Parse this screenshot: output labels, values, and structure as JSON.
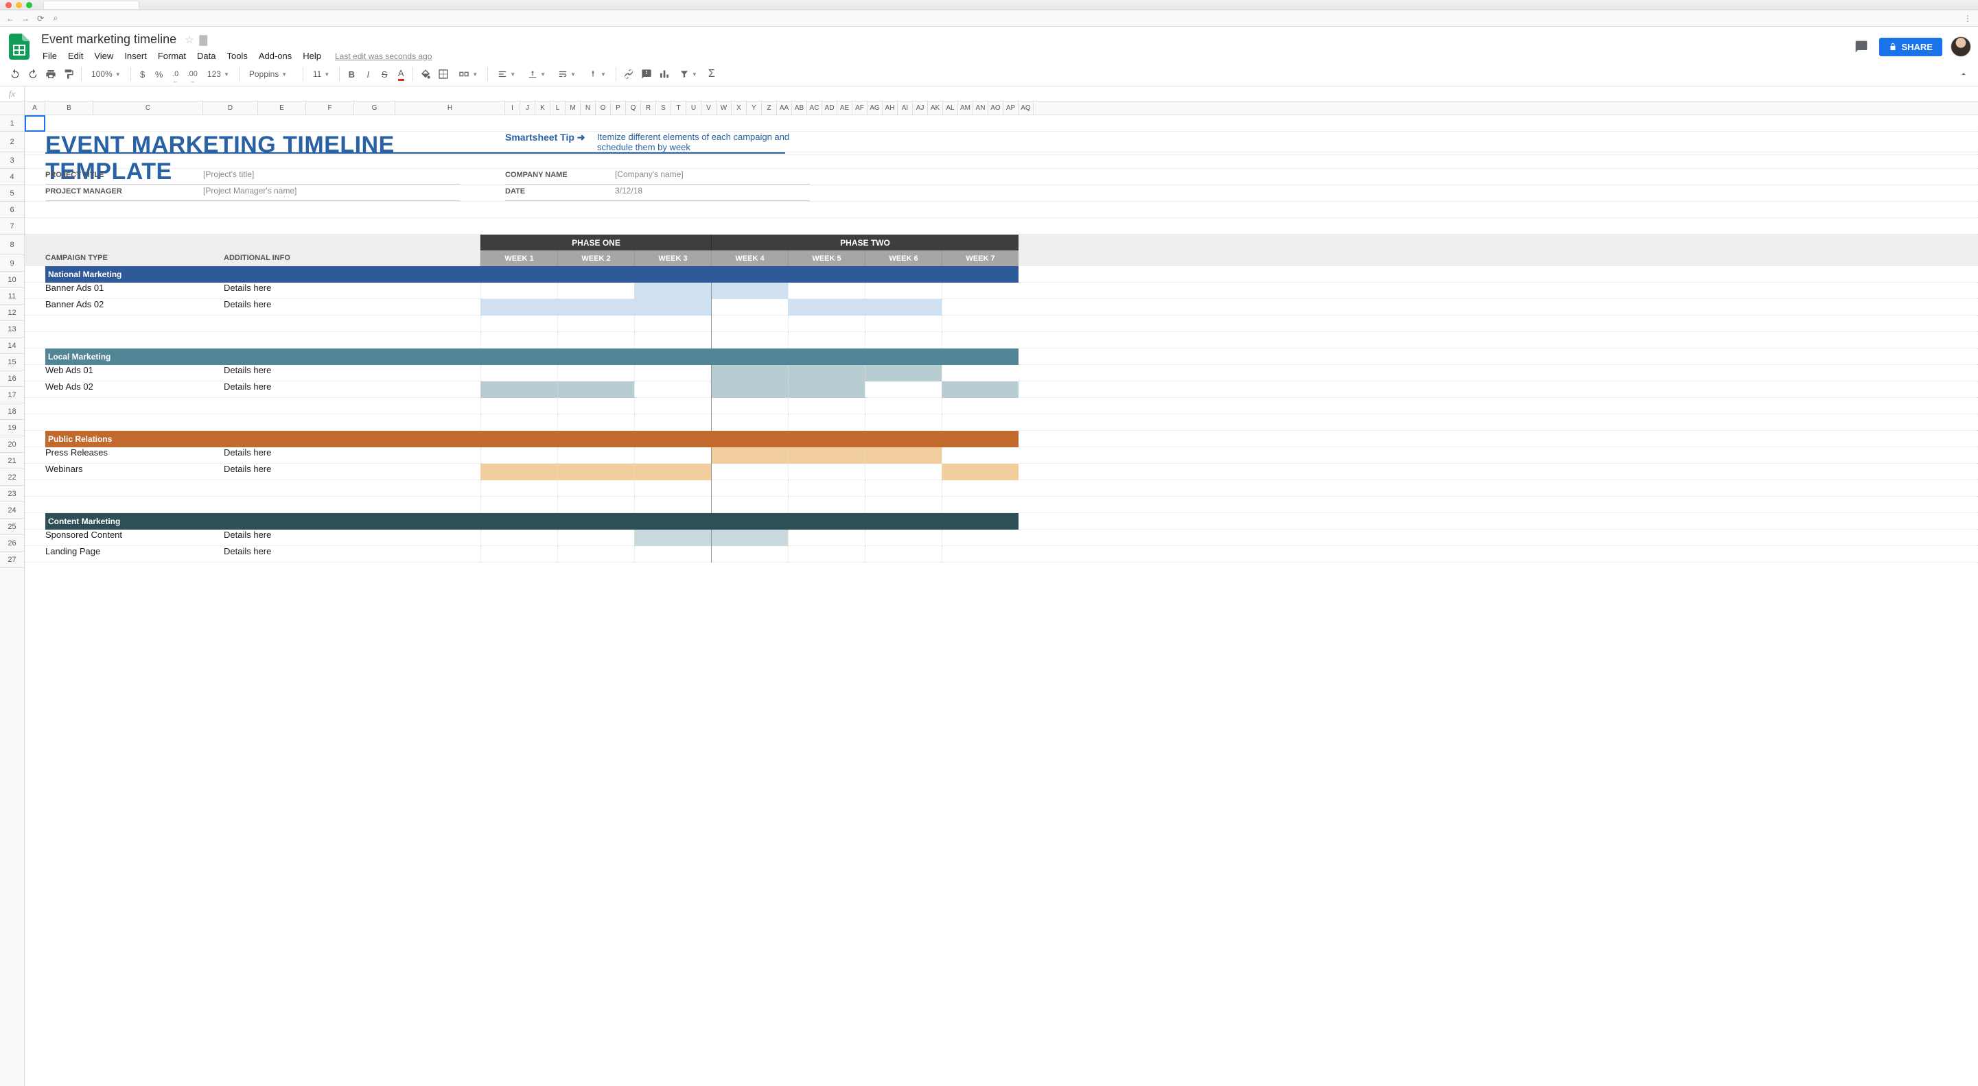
{
  "browser": {
    "back": "←",
    "forward": "→",
    "reload": "⟳",
    "menu": "⋮"
  },
  "doc": {
    "title": "Event marketing timeline",
    "last_edit": "Last edit was seconds ago",
    "share": "SHARE"
  },
  "menus": [
    "File",
    "Edit",
    "View",
    "Insert",
    "Format",
    "Data",
    "Tools",
    "Add-ons",
    "Help"
  ],
  "toolbar": {
    "zoom": "100%",
    "currency": "$",
    "percent": "%",
    "dec_dec": ".0",
    "dec_inc": ".00",
    "num": "123",
    "font": "Poppins",
    "size": "11"
  },
  "columns": [
    "A",
    "B",
    "C",
    "D",
    "E",
    "F",
    "G",
    "H",
    "I",
    "J",
    "K",
    "L",
    "M",
    "N",
    "O",
    "P",
    "Q",
    "R",
    "S",
    "T",
    "U",
    "V",
    "W",
    "X",
    "Y",
    "Z",
    "AA",
    "AB",
    "AC",
    "AD",
    "AE",
    "AF",
    "AG",
    "AH",
    "AI",
    "AJ",
    "AK",
    "AL",
    "AM",
    "AN",
    "AO",
    "AP",
    "AQ"
  ],
  "rows": [
    "1",
    "2",
    "3",
    "4",
    "5",
    "6",
    "7",
    "8",
    "9",
    "10",
    "11",
    "12",
    "13",
    "14",
    "15",
    "16",
    "17",
    "18",
    "19",
    "20",
    "21",
    "22",
    "23",
    "24",
    "25",
    "26",
    "27"
  ],
  "template": {
    "title": "EVENT MARKETING TIMELINE TEMPLATE",
    "tip_link": "Smartsheet Tip ➜",
    "tip_text": "Itemize different elements of each campaign and schedule them by week",
    "meta": {
      "project_title_label": "PROJECT TITLE",
      "project_title_value": "[Project's title]",
      "project_manager_label": "PROJECT MANAGER",
      "project_manager_value": "[Project Manager's name]",
      "company_label": "COMPANY NAME",
      "company_value": "[Company's name]",
      "date_label": "DATE",
      "date_value": "3/12/18"
    },
    "headers": {
      "campaign": "CAMPAIGN TYPE",
      "info": "ADDITIONAL INFO",
      "phase1": "PHASE ONE",
      "phase2": "PHASE TWO",
      "weeks": [
        "WEEK 1",
        "WEEK 2",
        "WEEK 3",
        "WEEK 4",
        "WEEK 5",
        "WEEK 6",
        "WEEK 7"
      ]
    },
    "categories": [
      {
        "name": "National Marketing",
        "class": "cat-national",
        "fill": "fill-nat",
        "tasks": [
          {
            "name": "Banner Ads 01",
            "info": "Details here",
            "weeks": [
              0,
              0,
              1,
              1,
              0,
              0,
              0
            ]
          },
          {
            "name": "Banner Ads 02",
            "info": "Details here",
            "weeks": [
              1,
              1,
              1,
              0,
              1,
              1,
              0
            ]
          }
        ],
        "blanks": 2
      },
      {
        "name": "Local Marketing",
        "class": "cat-local",
        "fill": "fill-loc",
        "tasks": [
          {
            "name": "Web Ads 01",
            "info": "Details here",
            "weeks": [
              0,
              0,
              0,
              1,
              1,
              1,
              0
            ]
          },
          {
            "name": "Web Ads 02",
            "info": "Details here",
            "weeks": [
              1,
              1,
              0,
              1,
              1,
              0,
              1
            ]
          }
        ],
        "blanks": 2
      },
      {
        "name": "Public Relations",
        "class": "cat-pr",
        "fill": "fill-pr",
        "tasks": [
          {
            "name": "Press Releases",
            "info": "Details here",
            "weeks": [
              0,
              0,
              0,
              1,
              1,
              1,
              0
            ]
          },
          {
            "name": "Webinars",
            "info": "Details here",
            "weeks": [
              1,
              1,
              1,
              0,
              0,
              0,
              1
            ]
          }
        ],
        "blanks": 2
      },
      {
        "name": "Content Marketing",
        "class": "cat-content",
        "fill": "fill-con",
        "tasks": [
          {
            "name": "Sponsored Content",
            "info": "Details here",
            "weeks": [
              0,
              0,
              1,
              1,
              0,
              0,
              0
            ]
          },
          {
            "name": "Landing Page",
            "info": "Details here",
            "weeks": [
              0,
              0,
              0,
              0,
              0,
              0,
              0
            ]
          }
        ],
        "blanks": 0
      }
    ]
  },
  "chart_data": {
    "type": "table",
    "title": "Event Marketing Timeline Template",
    "columns": [
      "Campaign Type",
      "Additional Info",
      "WEEK 1",
      "WEEK 2",
      "WEEK 3",
      "WEEK 4",
      "WEEK 5",
      "WEEK 6",
      "WEEK 7"
    ],
    "phases": {
      "PHASE ONE": [
        "WEEK 1",
        "WEEK 2",
        "WEEK 3"
      ],
      "PHASE TWO": [
        "WEEK 4",
        "WEEK 5",
        "WEEK 6",
        "WEEK 7"
      ]
    },
    "rows": [
      {
        "category": "National Marketing",
        "task": "Banner Ads 01",
        "info": "Details here",
        "weeks": [
          0,
          0,
          1,
          1,
          0,
          0,
          0
        ]
      },
      {
        "category": "National Marketing",
        "task": "Banner Ads 02",
        "info": "Details here",
        "weeks": [
          1,
          1,
          1,
          0,
          1,
          1,
          0
        ]
      },
      {
        "category": "Local Marketing",
        "task": "Web Ads 01",
        "info": "Details here",
        "weeks": [
          0,
          0,
          0,
          1,
          1,
          1,
          0
        ]
      },
      {
        "category": "Local Marketing",
        "task": "Web Ads 02",
        "info": "Details here",
        "weeks": [
          1,
          1,
          0,
          1,
          1,
          0,
          1
        ]
      },
      {
        "category": "Public Relations",
        "task": "Press Releases",
        "info": "Details here",
        "weeks": [
          0,
          0,
          0,
          1,
          1,
          1,
          0
        ]
      },
      {
        "category": "Public Relations",
        "task": "Webinars",
        "info": "Details here",
        "weeks": [
          1,
          1,
          1,
          0,
          0,
          0,
          1
        ]
      },
      {
        "category": "Content Marketing",
        "task": "Sponsored Content",
        "info": "Details here",
        "weeks": [
          0,
          0,
          1,
          1,
          0,
          0,
          0
        ]
      },
      {
        "category": "Content Marketing",
        "task": "Landing Page",
        "info": "Details here",
        "weeks": [
          0,
          0,
          0,
          0,
          0,
          0,
          0
        ]
      }
    ]
  }
}
